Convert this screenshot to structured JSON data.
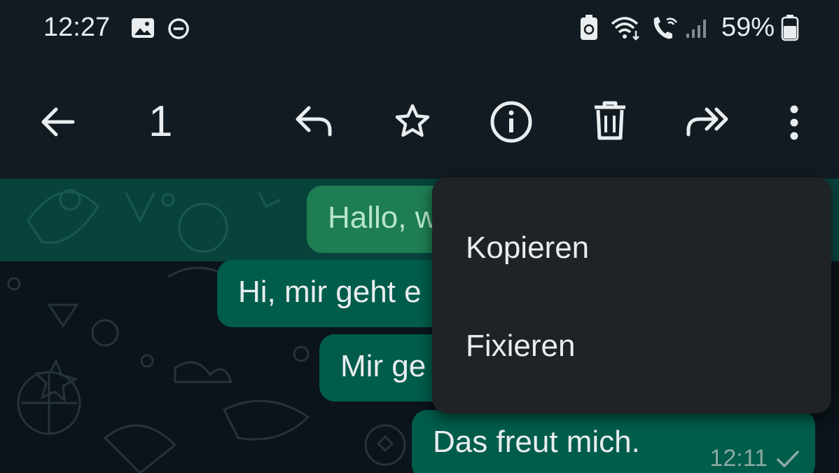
{
  "status_bar": {
    "time": "12:27",
    "battery_percent": "59%",
    "icons": [
      "gallery-icon",
      "dnd-icon",
      "battery-saver-icon",
      "wifi-icon",
      "wifi-call-icon",
      "signal-icon",
      "battery-icon"
    ]
  },
  "action_bar": {
    "selected_count": "1",
    "icons": [
      "back-arrow-icon",
      "reply-icon",
      "star-icon",
      "info-icon",
      "delete-icon",
      "forward-icon",
      "more-vert-icon"
    ]
  },
  "messages": [
    {
      "text": "Hallo, w",
      "selected": true
    },
    {
      "text": "Hi, mir geht e",
      "selected": false
    },
    {
      "text": "Mir ge",
      "selected": false
    },
    {
      "text": "Das freut mich.",
      "time": "12:11",
      "status": "sent-check-icon",
      "selected": false
    }
  ],
  "context_menu": {
    "items": [
      {
        "label": "Kopieren"
      },
      {
        "label": "Fixieren"
      }
    ]
  },
  "colors": {
    "bar_background": "#121b22",
    "chat_background": "#0b141a",
    "outgoing_bubble": "#005c4b",
    "menu_background": "#1f2326",
    "text": "#e9edef"
  }
}
